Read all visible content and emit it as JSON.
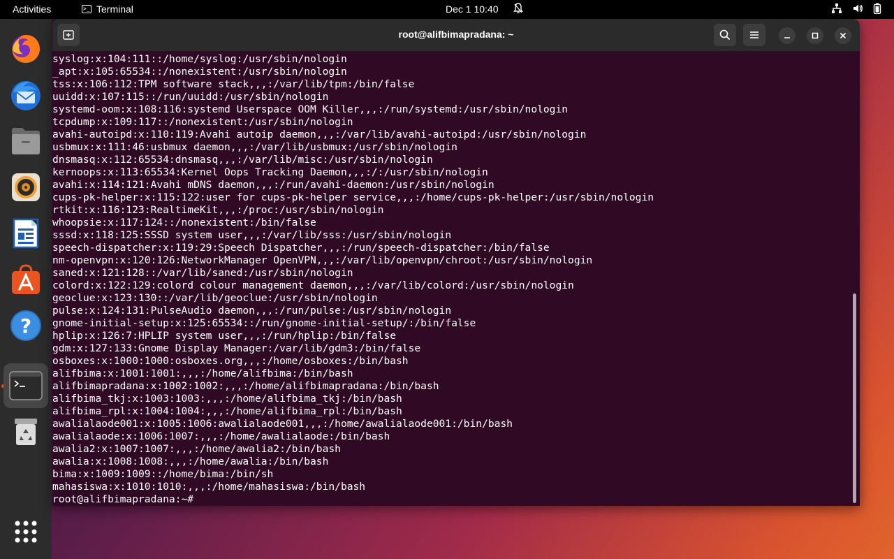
{
  "topbar": {
    "activities": "Activities",
    "app_name": "Terminal",
    "clock": "Dec 1  10:40"
  },
  "window": {
    "title": "root@alifbimapradana: ~"
  },
  "terminal": {
    "lines": [
      "syslog:x:104:111::/home/syslog:/usr/sbin/nologin",
      "_apt:x:105:65534::/nonexistent:/usr/sbin/nologin",
      "tss:x:106:112:TPM software stack,,,:/var/lib/tpm:/bin/false",
      "uuidd:x:107:115::/run/uuidd:/usr/sbin/nologin",
      "systemd-oom:x:108:116:systemd Userspace OOM Killer,,,:/run/systemd:/usr/sbin/nologin",
      "tcpdump:x:109:117::/nonexistent:/usr/sbin/nologin",
      "avahi-autoipd:x:110:119:Avahi autoip daemon,,,:/var/lib/avahi-autoipd:/usr/sbin/nologin",
      "usbmux:x:111:46:usbmux daemon,,,:/var/lib/usbmux:/usr/sbin/nologin",
      "dnsmasq:x:112:65534:dnsmasq,,,:/var/lib/misc:/usr/sbin/nologin",
      "kernoops:x:113:65534:Kernel Oops Tracking Daemon,,,:/:/usr/sbin/nologin",
      "avahi:x:114:121:Avahi mDNS daemon,,,:/run/avahi-daemon:/usr/sbin/nologin",
      "cups-pk-helper:x:115:122:user for cups-pk-helper service,,,:/home/cups-pk-helper:/usr/sbin/nologin",
      "rtkit:x:116:123:RealtimeKit,,,:/proc:/usr/sbin/nologin",
      "whoopsie:x:117:124::/nonexistent:/bin/false",
      "sssd:x:118:125:SSSD system user,,,:/var/lib/sss:/usr/sbin/nologin",
      "speech-dispatcher:x:119:29:Speech Dispatcher,,,:/run/speech-dispatcher:/bin/false",
      "nm-openvpn:x:120:126:NetworkManager OpenVPN,,,:/var/lib/openvpn/chroot:/usr/sbin/nologin",
      "saned:x:121:128::/var/lib/saned:/usr/sbin/nologin",
      "colord:x:122:129:colord colour management daemon,,,:/var/lib/colord:/usr/sbin/nologin",
      "geoclue:x:123:130::/var/lib/geoclue:/usr/sbin/nologin",
      "pulse:x:124:131:PulseAudio daemon,,,:/run/pulse:/usr/sbin/nologin",
      "gnome-initial-setup:x:125:65534::/run/gnome-initial-setup/:/bin/false",
      "hplip:x:126:7:HPLIP system user,,,:/run/hplip:/bin/false",
      "gdm:x:127:133:Gnome Display Manager:/var/lib/gdm3:/bin/false",
      "osboxes:x:1000:1000:osboxes.org,,,:/home/osboxes:/bin/bash",
      "alifbima:x:1001:1001:,,,:/home/alifbima:/bin/bash",
      "alifbimapradana:x:1002:1002:,,,:/home/alifbimapradana:/bin/bash",
      "alifbima_tkj:x:1003:1003:,,,:/home/alifbima_tkj:/bin/bash",
      "alifbima_rpl:x:1004:1004:,,,:/home/alifbima_rpl:/bin/bash",
      "awalialaode001:x:1005:1006:awalialaode001,,,:/home/awalialaode001:/bin/bash",
      "awalialaode:x:1006:1007:,,,:/home/awalialaode:/bin/bash",
      "awalia2:x:1007:1007:,,,:/home/awalia2:/bin/bash",
      "awalia:x:1008:1008:,,,:/home/awalia:/bin/bash",
      "bima:x:1009:1009::/home/bima:/bin/sh",
      "mahasiswa:x:1010:1010:,,,:/home/mahasiswa:/bin/bash"
    ],
    "prompt": "root@alifbimapradana:~#"
  },
  "dock": {
    "items": [
      "firefox-icon",
      "thunderbird-icon",
      "files-icon",
      "rhythmbox-icon",
      "libreoffice-writer-icon",
      "software-center-icon",
      "help-icon",
      "terminal-icon",
      "trash-icon",
      "show-apps-icon"
    ]
  },
  "colors": {
    "terminal_bg": "#300a24",
    "headerbar_bg": "#2b2b2b",
    "accent": "#e95420"
  }
}
